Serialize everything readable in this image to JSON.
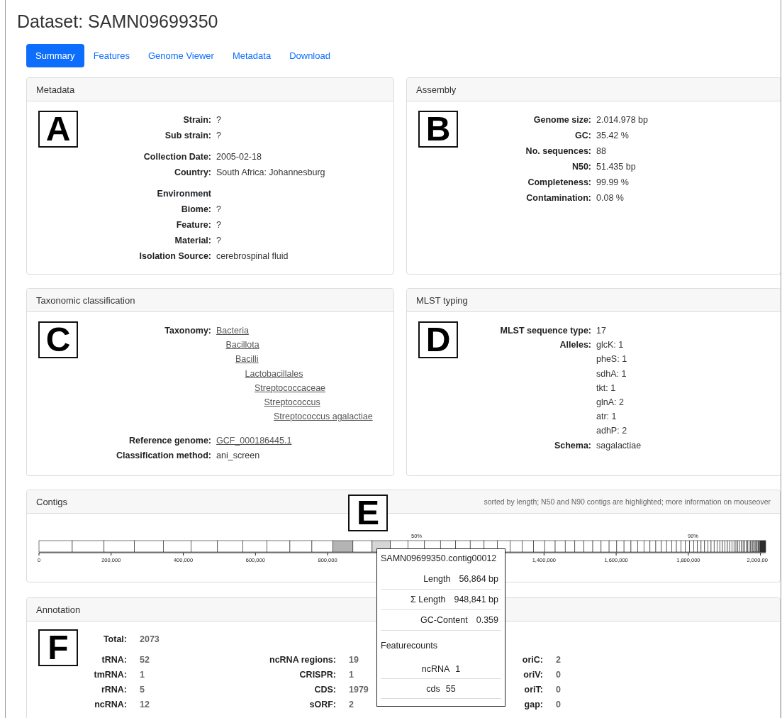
{
  "title": "Dataset: SAMN09699350",
  "tabs": [
    {
      "label": "Summary",
      "selected": true
    },
    {
      "label": "Features",
      "selected": false
    },
    {
      "label": "Genome Viewer",
      "selected": false
    },
    {
      "label": "Metadata",
      "selected": false
    },
    {
      "label": "Download",
      "selected": false
    }
  ],
  "metadata": {
    "header": "Metadata",
    "panel_letter": "A",
    "groups": [
      [
        {
          "kind": "field",
          "label": "Strain:",
          "value": "?"
        },
        {
          "kind": "field",
          "label": "Sub strain:",
          "value": "?"
        }
      ],
      [
        {
          "kind": "field",
          "label": "Collection Date:",
          "value": "2005-02-18"
        },
        {
          "kind": "field",
          "label": "Country:",
          "value": "South Africa: Johannesburg"
        }
      ],
      [
        {
          "kind": "heading",
          "label": "Environment"
        },
        {
          "kind": "field",
          "label": "Biome:",
          "value": "?"
        },
        {
          "kind": "field",
          "label": "Feature:",
          "value": "?"
        },
        {
          "kind": "field",
          "label": "Material:",
          "value": "?"
        },
        {
          "kind": "field",
          "label": "Isolation Source:",
          "value": "cerebrospinal fluid"
        }
      ]
    ]
  },
  "assembly": {
    "header": "Assembly",
    "panel_letter": "B",
    "groups": [
      [
        {
          "kind": "field",
          "label": "Genome size:",
          "value": "2.014.978 bp"
        },
        {
          "kind": "field",
          "label": "GC:",
          "value": "35.42 %"
        },
        {
          "kind": "field",
          "label": "No. sequences:",
          "value": "88"
        },
        {
          "kind": "field",
          "label": "N50:",
          "value": "51.435 bp"
        },
        {
          "kind": "field",
          "label": "Completeness:",
          "value": "99.99 %"
        },
        {
          "kind": "field",
          "label": "Contamination:",
          "value": "0.08 %"
        }
      ]
    ]
  },
  "taxonomic_classification": {
    "header": "Taxonomic classification",
    "panel_letter": "C",
    "taxonomy": {
      "label": "Taxonomy:",
      "tree": [
        {
          "name": "Bacteria",
          "children": [
            {
              "name": "Bacillota",
              "children": [
                {
                  "name": "Bacilli",
                  "children": [
                    {
                      "name": "Lactobacillales",
                      "children": [
                        {
                          "name": "Streptococcaceae",
                          "children": [
                            {
                              "name": "Streptococcus",
                              "children": [
                                {
                                  "name": "Streptococcus agalactiae"
                                }
                              ]
                            }
                          ]
                        }
                      ]
                    }
                  ]
                }
              ]
            }
          ]
        }
      ]
    },
    "reference_genome": {
      "label": "Reference genome:",
      "value": "GCF_000186445.1"
    },
    "classification_method": {
      "label": "Classification method:",
      "value": "ani_screen"
    }
  },
  "mlst_typing": {
    "header": "MLST typing",
    "panel_letter": "D",
    "sequence_type": {
      "label": "MLST sequence type:",
      "value": "17"
    },
    "alleles": {
      "label": "Alleles:",
      "values": [
        "glcK: 1",
        "pheS: 1",
        "sdhA: 1",
        "tkt: 1",
        "glnA: 2",
        "atr: 1",
        "adhP: 2"
      ]
    },
    "schema": {
      "label": "Schema:",
      "value": "sagalactiae"
    }
  },
  "contigs": {
    "header": "Contigs",
    "panel_letter": "E",
    "note": "sorted by length; N50 and N90 contigs are highlighted; more information on mouseover",
    "markers": [
      "50%",
      "90%"
    ],
    "axis_labels": [
      "0",
      "200,000",
      "400,000",
      "600,000",
      "800,000",
      "1,400,000",
      "1,600,000",
      "1,800,000",
      "2,000,00"
    ],
    "tooltip": {
      "title": "SAMN09699350.contig00012",
      "rows": [
        {
          "label": "Length",
          "value": "56,864 bp"
        },
        {
          "label": "Σ Length",
          "value": "948,841 bp"
        },
        {
          "label": "GC-Content",
          "value": "0.359"
        }
      ],
      "section": "Featurecounts",
      "counts": [
        {
          "label": "ncRNA",
          "value": "1"
        },
        {
          "label": "cds",
          "value": "55"
        }
      ]
    }
  },
  "annotation": {
    "header": "Annotation",
    "panel_letter": "F",
    "total": {
      "label": "Total:",
      "value": "2073"
    },
    "columns": [
      [
        {
          "label": "tRNA:",
          "value": "52"
        },
        {
          "label": "tmRNA:",
          "value": "1"
        },
        {
          "label": "rRNA:",
          "value": "5"
        },
        {
          "label": "ncRNA:",
          "value": "12"
        }
      ],
      [
        {
          "label": "ncRNA regions:",
          "value": "19"
        },
        {
          "label": "CRISPR:",
          "value": "1"
        },
        {
          "label": "CDS:",
          "value": "1979"
        },
        {
          "label": "sORF:",
          "value": "2"
        }
      ],
      [
        {
          "label": "oriC:",
          "value": "2"
        },
        {
          "label": "oriV:",
          "value": "0"
        },
        {
          "label": "oriT:",
          "value": "0"
        },
        {
          "label": "gap:",
          "value": "0"
        }
      ]
    ]
  }
}
